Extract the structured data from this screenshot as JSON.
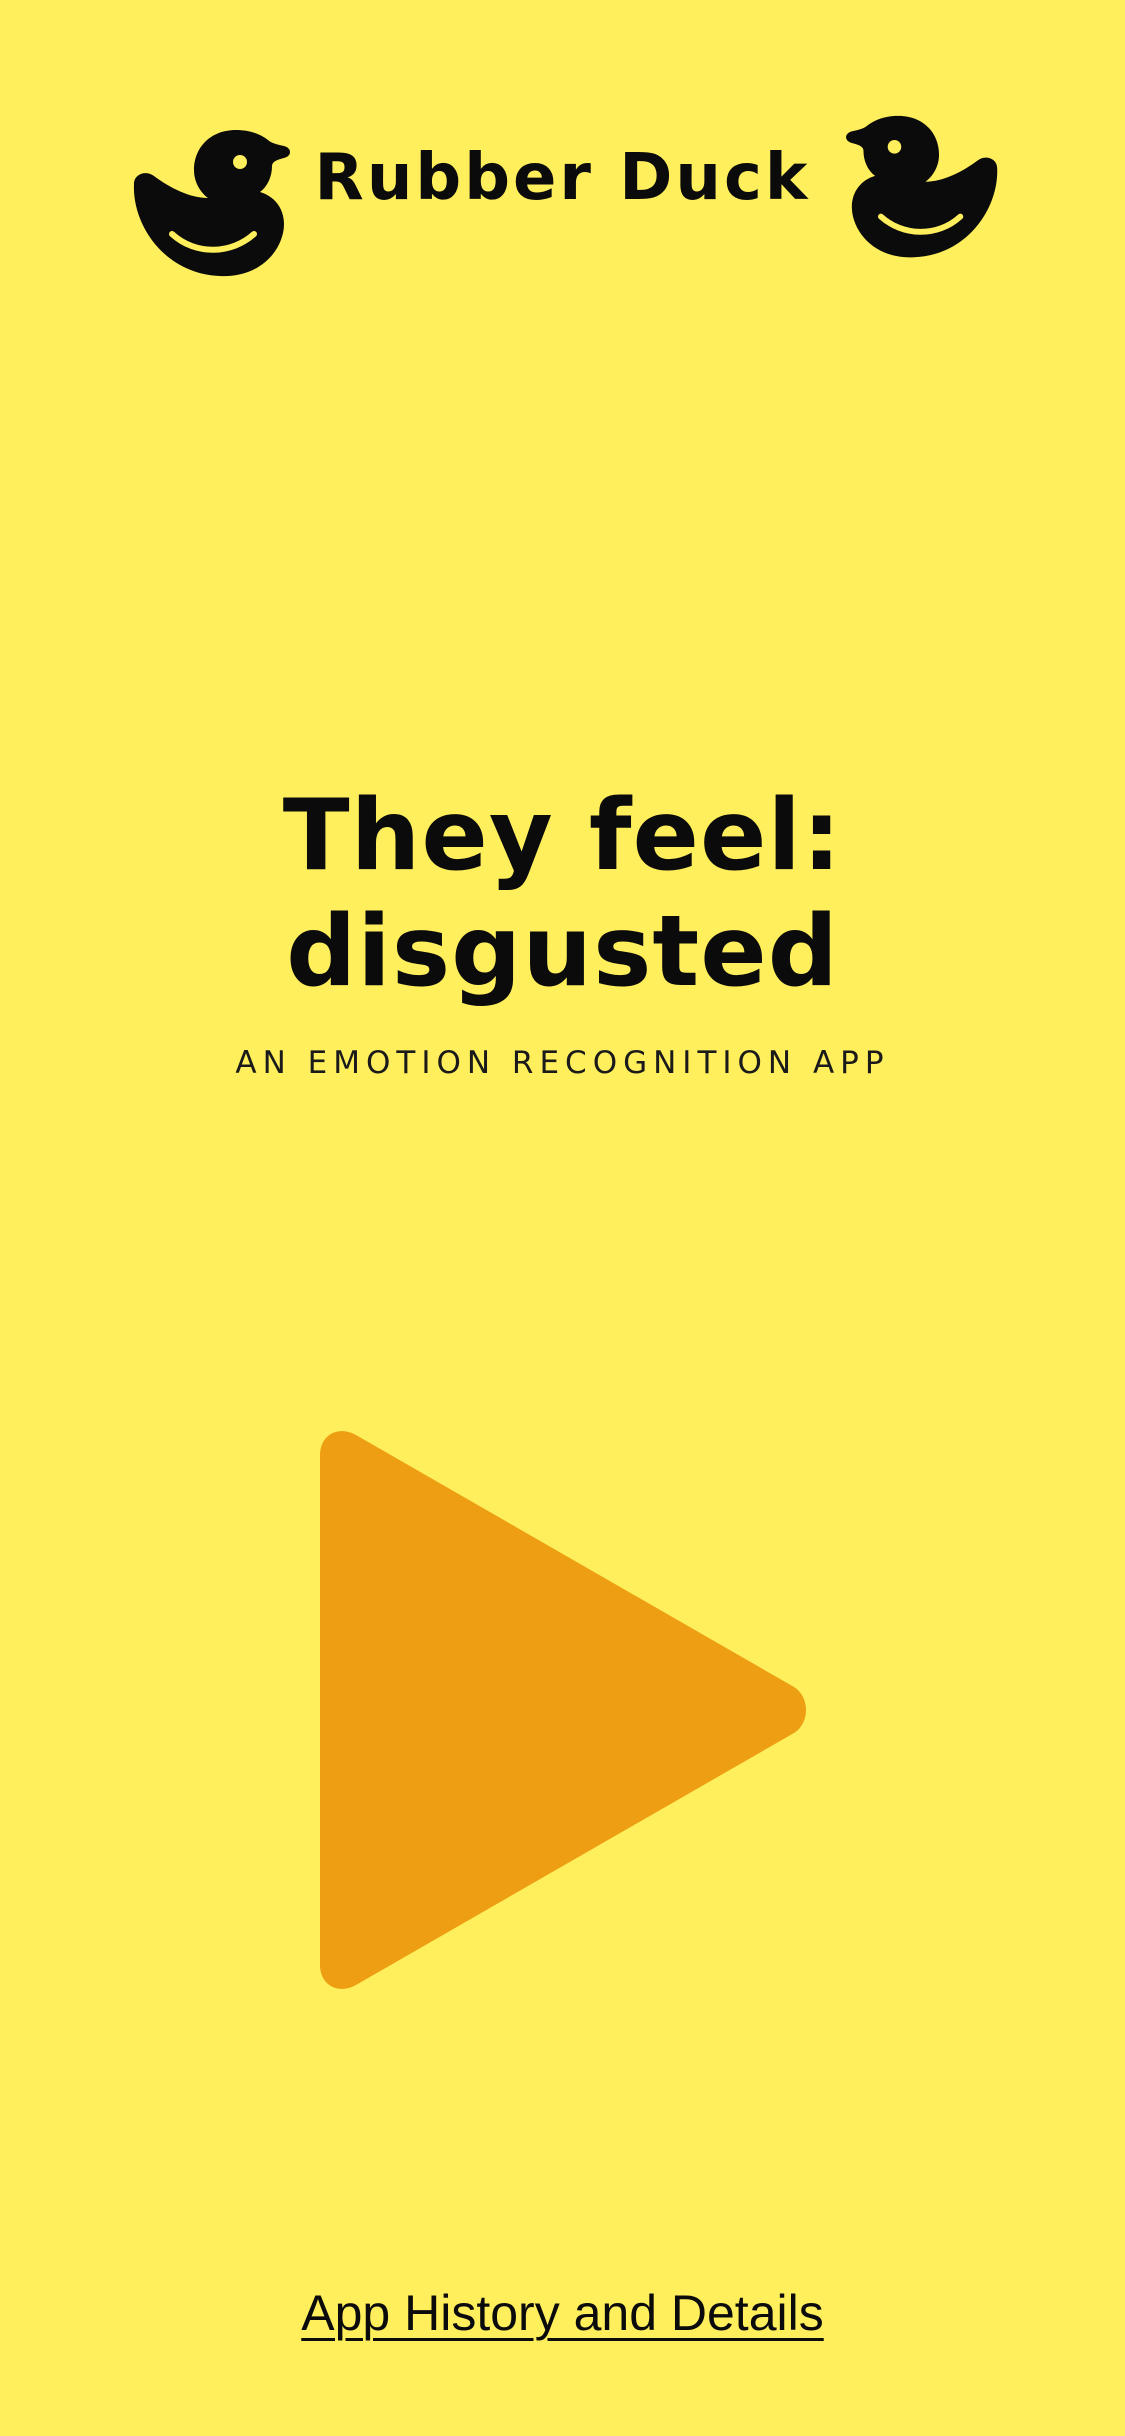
{
  "header": {
    "title": "Rubber Duck",
    "left_icon": "rubber-duck-icon",
    "right_icon": "rubber-duck-icon"
  },
  "emotion": {
    "prefix": "They feel:",
    "value": "disgusted"
  },
  "tagline": "AN EMOTION RECOGNITION APP",
  "play_button": {
    "icon": "play-icon",
    "color": "#EE9E12"
  },
  "footer": {
    "link_label": "App History and Details"
  },
  "colors": {
    "background": "#FFEF5C",
    "text": "#0b0b0b",
    "accent": "#EE9E12"
  }
}
